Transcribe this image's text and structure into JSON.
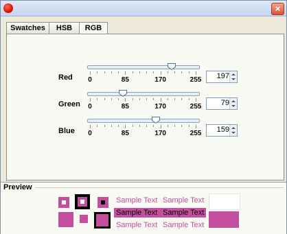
{
  "window": {
    "close_glyph": "×"
  },
  "tabs": [
    {
      "label": "Swatches",
      "active": false
    },
    {
      "label": "HSB",
      "active": false
    },
    {
      "label": "RGB",
      "active": true
    }
  ],
  "sliders": [
    {
      "label": "Red",
      "value": "197",
      "position": 197
    },
    {
      "label": "Green",
      "value": "79",
      "position": 79
    },
    {
      "label": "Blue",
      "value": "159",
      "position": 159
    }
  ],
  "scale": {
    "min": 0,
    "max": 255,
    "labels": [
      "0",
      "85",
      "170",
      "255"
    ]
  },
  "preview": {
    "title": "Preview",
    "selected_color": "#c54f9f",
    "sample_text": "Sample Text",
    "row_texts": [
      "Sample Text",
      "Sample Text",
      "Sample Text",
      "Sample Text",
      "Sample Text",
      "Sample Text"
    ]
  },
  "icons": {
    "window-dot": "red-circle-icon",
    "close": "close-icon",
    "spinner": "spinner-arrows-icon"
  }
}
